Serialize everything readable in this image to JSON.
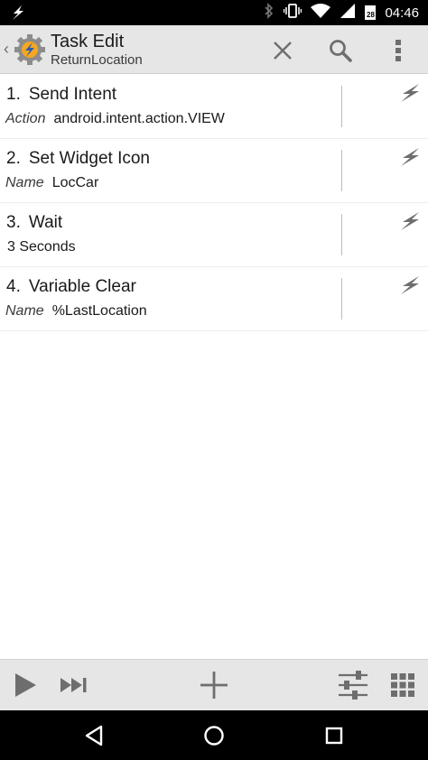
{
  "status_bar": {
    "time": "04:46",
    "calendar_day": "28",
    "icons": [
      "tasker-bolt-icon",
      "bluetooth-icon",
      "vibrate-icon",
      "wifi-icon",
      "cell-signal-icon",
      "calendar-icon"
    ]
  },
  "action_bar": {
    "title": "Task Edit",
    "subtitle": "ReturnLocation",
    "back_glyph": "‹",
    "actions": [
      "close-icon",
      "search-icon",
      "overflow-menu-icon"
    ]
  },
  "tasks": [
    {
      "number": "1.",
      "title": "Send Intent",
      "detail_label": "Action",
      "detail_value": "android.intent.action.VIEW"
    },
    {
      "number": "2.",
      "title": "Set Widget Icon",
      "detail_label": "Name",
      "detail_value": "LocCar"
    },
    {
      "number": "3.",
      "title": "Wait",
      "detail_label": "",
      "detail_value": "3 Seconds"
    },
    {
      "number": "4.",
      "title": "Variable Clear",
      "detail_label": "Name",
      "detail_value": "%LastLocation"
    }
  ],
  "bottom_toolbar": [
    "play-icon",
    "skip-forward-icon",
    "plus-icon",
    "sliders-icon",
    "grid-icon"
  ],
  "nav_bar": [
    "back-icon",
    "home-icon",
    "recents-icon"
  ],
  "colors": {
    "action_bar_bg": "#e6e6e6",
    "icon_gray": "#6e6e6e",
    "status_bar_bg": "#000000",
    "accent_orange": "#f5a623"
  }
}
